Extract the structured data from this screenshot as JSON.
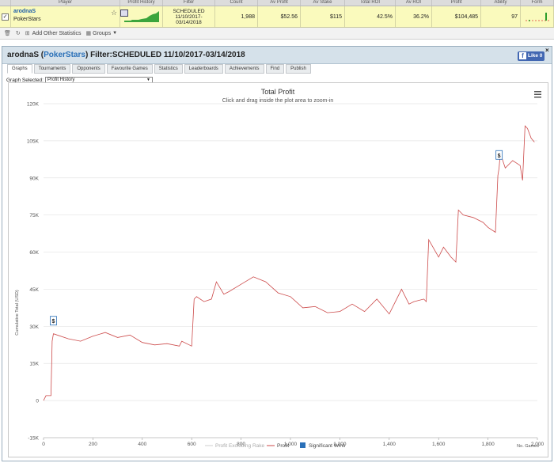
{
  "header": {
    "columns": [
      "Player",
      "Profit History",
      "Filter",
      "Count",
      "Av Profit",
      "Av Stake",
      "Total ROI",
      "Av ROI",
      "Profit",
      "Ability",
      "Form"
    ]
  },
  "row": {
    "player_name": "arodnaS",
    "site": "PokerStars",
    "filter_line1": "SCHEDULED",
    "filter_line2": "11/10/2017-",
    "filter_line3": "03/14/2018",
    "count": "1,988",
    "av_profit": "$52.56",
    "av_stake": "$115",
    "total_roi": "42.5%",
    "av_roi": "36.2%",
    "profit": "$104,485",
    "ability": "97"
  },
  "toolbar": {
    "add_stats": "Add Other Statistics",
    "groups": "Groups"
  },
  "panel": {
    "player": "arodnaS",
    "site": "PokerStars",
    "filter_text": "Filter:SCHEDULED 11/10/2017-03/14/2018",
    "like_label": "Like 0",
    "tabs": [
      "Graphs",
      "Tournaments",
      "Opponents",
      "Favourite Games",
      "Statistics",
      "Leaderboards",
      "Achievements",
      "Find",
      "Publish"
    ],
    "graph_selected_label": "Graph Selected:",
    "graph_selected_value": "Profit History"
  },
  "chart_data": {
    "type": "line",
    "title": "Total Profit",
    "subtitle": "Click and drag inside the plot area to zoom-in",
    "ylabel": "Cumulative Total (USD)",
    "xlabel": "No. Games",
    "ylim": [
      -15000,
      120000
    ],
    "xlim": [
      0,
      2000
    ],
    "y_ticks": [
      "-15K",
      "0",
      "15K",
      "30K",
      "45K",
      "60K",
      "75K",
      "90K",
      "105K",
      "120K"
    ],
    "x_ticks": [
      "0",
      "200",
      "400",
      "600",
      "800",
      "1,000",
      "1,200",
      "1,400",
      "1,600",
      "1,800",
      "2,000"
    ],
    "legend": [
      "Profit Excluding Rake",
      "Profit",
      "Significant Wins"
    ],
    "legend_position": "bottom",
    "grid": true,
    "series": [
      {
        "name": "Profit",
        "color": "#cc4a4a",
        "x": [
          0,
          10,
          30,
          35,
          40,
          100,
          150,
          200,
          250,
          300,
          350,
          400,
          450,
          500,
          550,
          560,
          600,
          610,
          620,
          650,
          680,
          700,
          730,
          750,
          800,
          850,
          900,
          950,
          1000,
          1050,
          1100,
          1150,
          1200,
          1250,
          1300,
          1350,
          1400,
          1450,
          1480,
          1500,
          1540,
          1550,
          1560,
          1600,
          1620,
          1650,
          1670,
          1680,
          1700,
          1740,
          1780,
          1800,
          1830,
          1840,
          1845,
          1850,
          1870,
          1900,
          1930,
          1940,
          1950,
          1960,
          1975,
          1988
        ],
        "values": [
          0,
          2000,
          2000,
          24000,
          27000,
          25000,
          24000,
          26000,
          27500,
          25500,
          26500,
          23500,
          22500,
          23000,
          22000,
          24000,
          22000,
          41000,
          42000,
          40000,
          41000,
          48000,
          43000,
          44000,
          47000,
          50000,
          48000,
          43500,
          42000,
          37500,
          38000,
          35500,
          36000,
          39000,
          36000,
          41000,
          35000,
          45000,
          39000,
          40000,
          41000,
          40000,
          65000,
          58000,
          62000,
          58000,
          56000,
          77000,
          75000,
          74000,
          72000,
          70000,
          68000,
          91000,
          94000,
          100000,
          94000,
          97000,
          95000,
          89000,
          111000,
          110000,
          106000,
          104485
        ]
      }
    ],
    "significant_wins": [
      {
        "x": 40,
        "label": "$"
      },
      {
        "x": 1845,
        "label": "$"
      }
    ]
  }
}
